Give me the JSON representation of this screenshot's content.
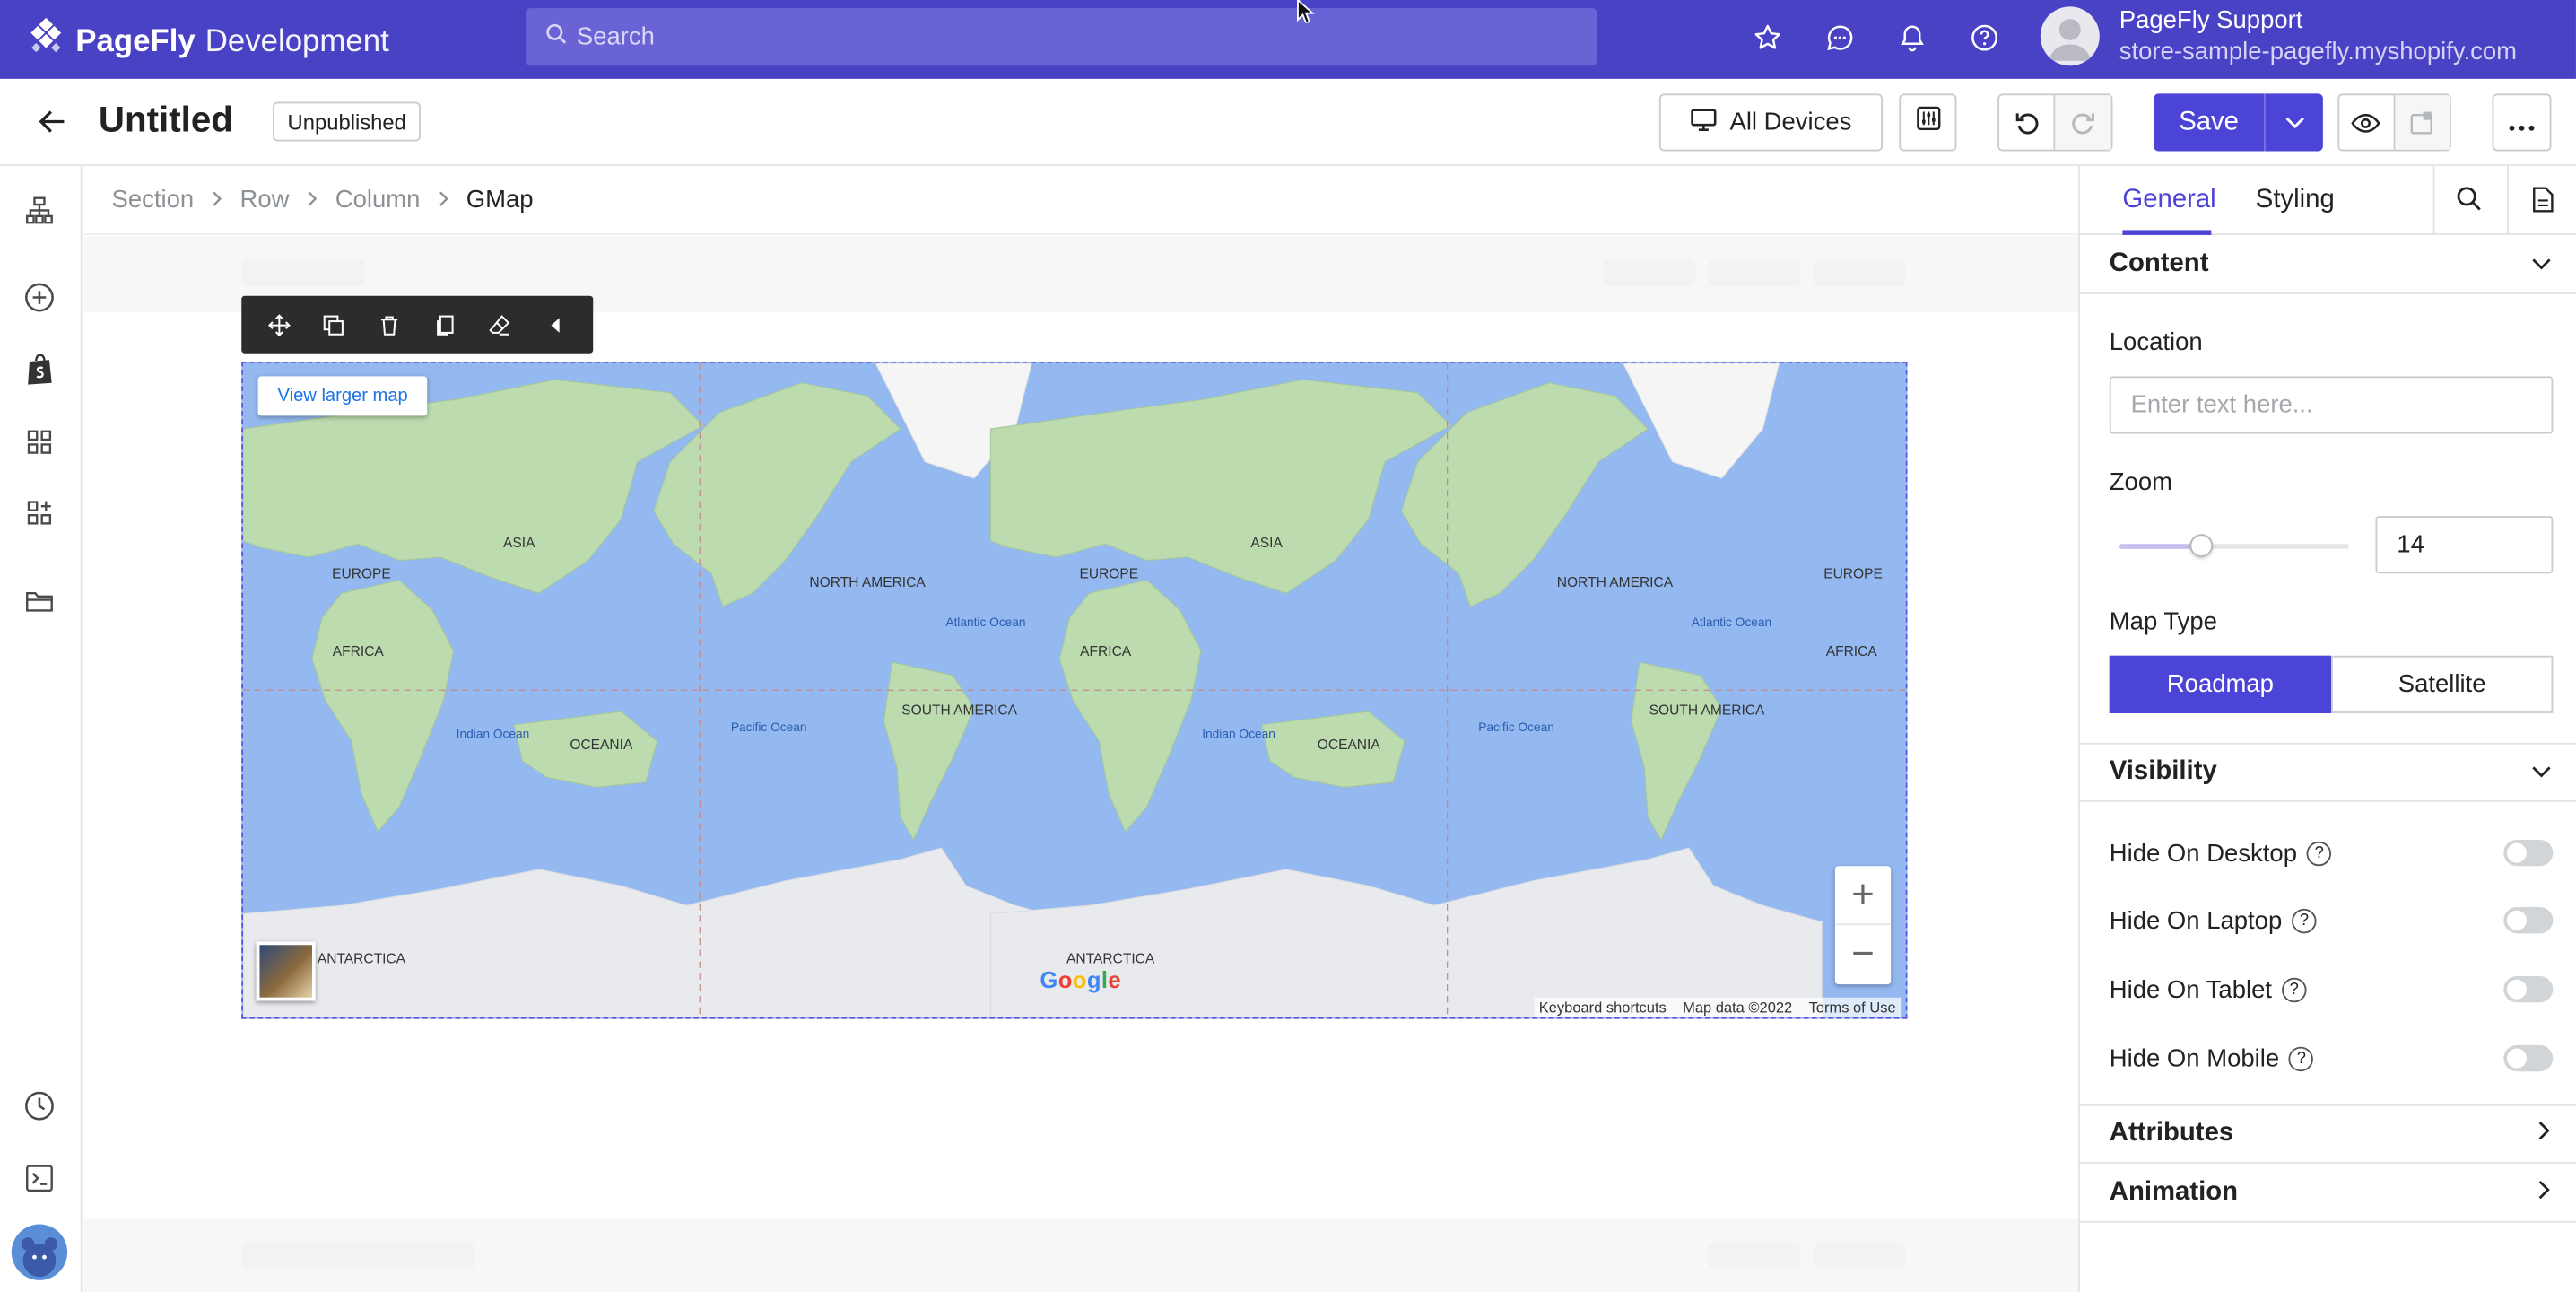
{
  "topbar": {
    "brand": "PageFly",
    "env": "Development",
    "search_placeholder": "Search",
    "user_name": "PageFly Support",
    "user_store": "store-sample-pagefly.myshopify.com"
  },
  "toolbar": {
    "page_title": "Untitled",
    "status": "Unpublished",
    "devices_label": "All Devices",
    "save_label": "Save"
  },
  "breadcrumb": [
    "Section",
    "Row",
    "Column",
    "GMap"
  ],
  "map": {
    "view_larger": "View larger map",
    "google": "Google",
    "keyboard": "Keyboard shortcuts",
    "mapdata": "Map data ©2022",
    "terms": "Terms of Use",
    "zoom_in": "+",
    "zoom_out": "−",
    "labels": {
      "asia": "ASIA",
      "europe": "EUROPE",
      "africa": "AFRICA",
      "oceania": "OCEANIA",
      "north_america": "NORTH AMERICA",
      "south_america": "SOUTH AMERICA",
      "antarctica": "ANTARCTICA",
      "atlantic": "Atlantic Ocean",
      "pacific": "Pacific Ocean",
      "indian": "Indian Ocean"
    }
  },
  "panel": {
    "tab_general": "General",
    "tab_styling": "Styling",
    "content_title": "Content",
    "location_label": "Location",
    "location_placeholder": "Enter text here...",
    "zoom_label": "Zoom",
    "zoom_value": "14",
    "zoom_fraction": 0.36,
    "map_type_label": "Map Type",
    "map_type_options": [
      "Roadmap",
      "Satellite"
    ],
    "map_type_selected": "Roadmap",
    "visibility_title": "Visibility",
    "hide_desktop": "Hide On Desktop",
    "hide_laptop": "Hide On Laptop",
    "hide_tablet": "Hide On Tablet",
    "hide_mobile": "Hide On Mobile",
    "attributes_title": "Attributes",
    "animation_title": "Animation"
  },
  "colors": {
    "brand": "#4a42c5",
    "accent": "#4c44d6",
    "ocean": "#94b8f0",
    "land": "#bcdcb0"
  }
}
